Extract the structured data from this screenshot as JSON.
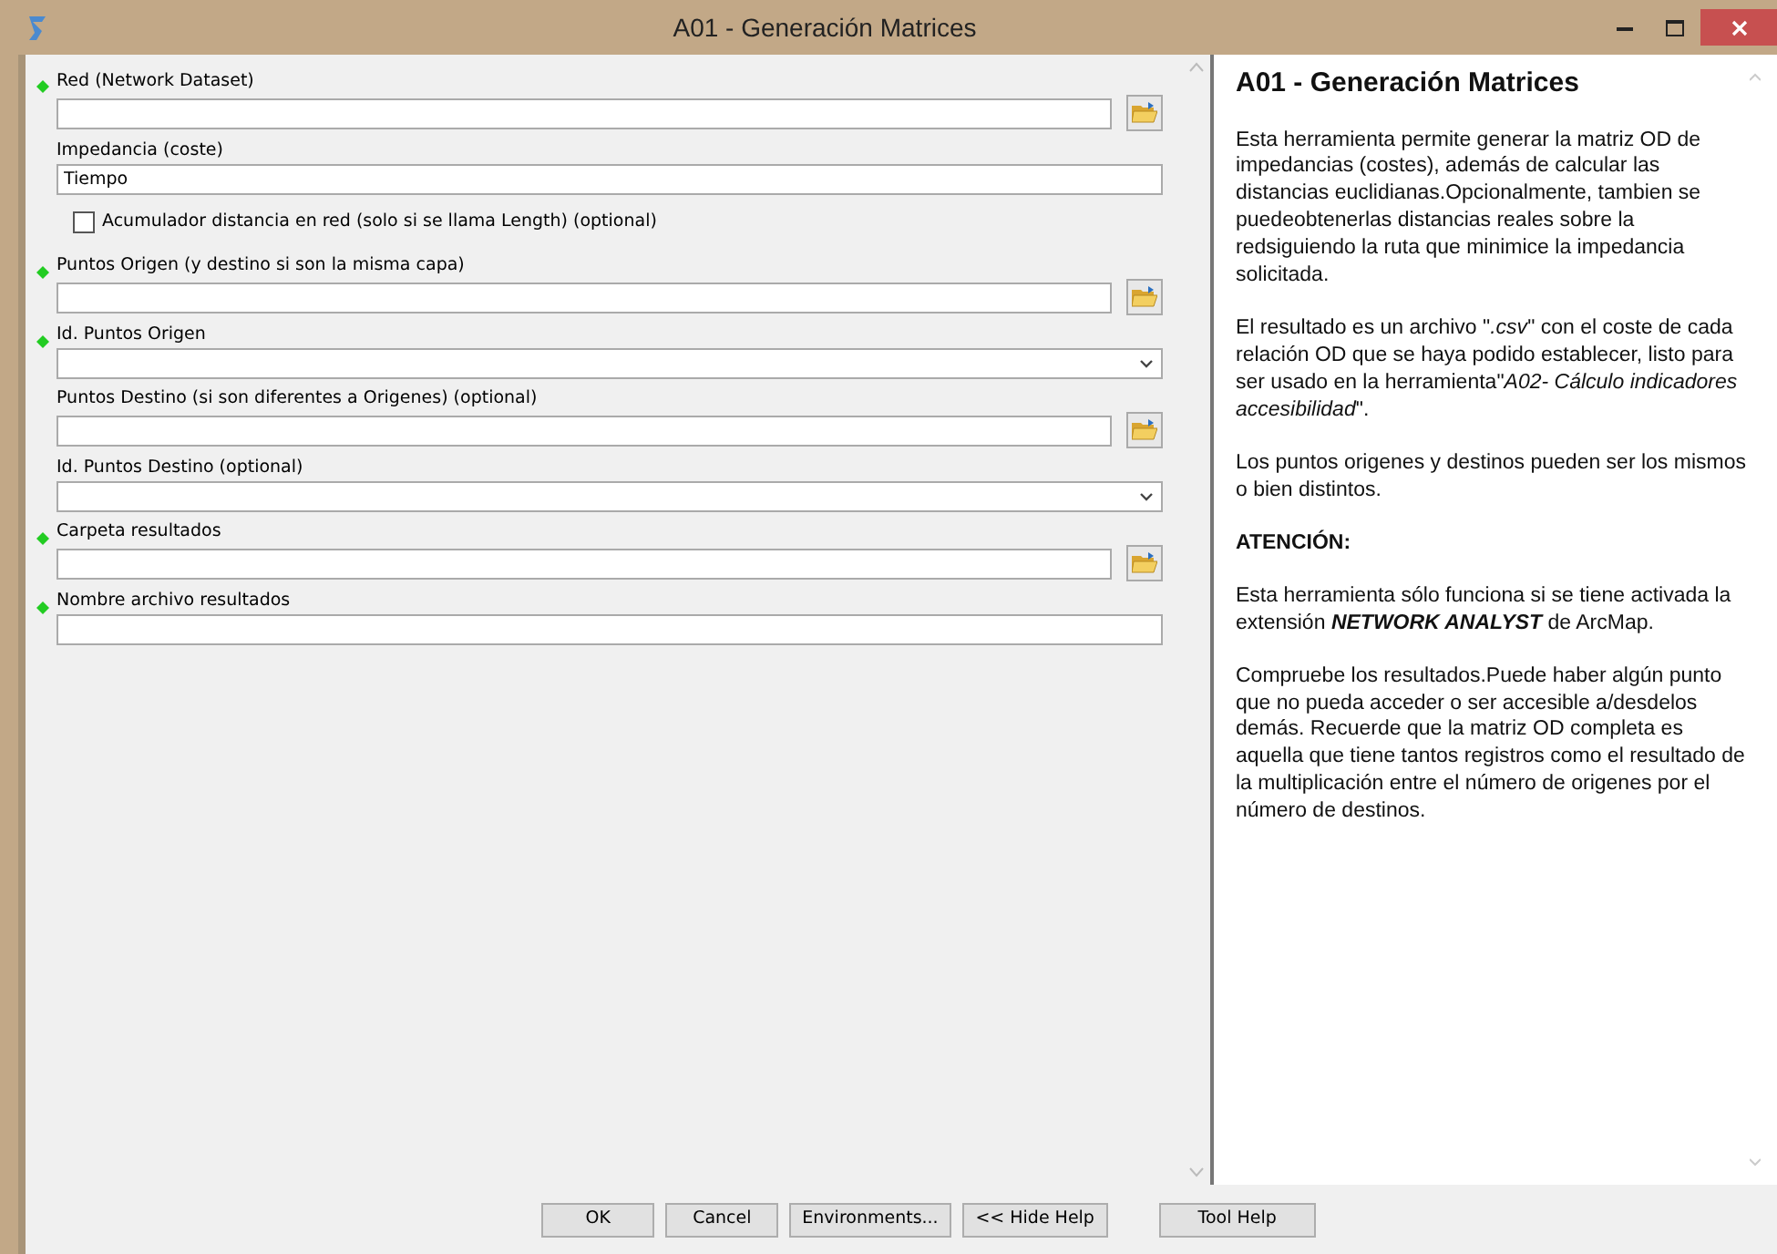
{
  "window": {
    "title": "A01 - Generación Matrices"
  },
  "parameters": [
    {
      "kind": "text",
      "label": "Red (Network Dataset)",
      "required": true,
      "browse": true
    },
    {
      "kind": "text",
      "label": "Impedancia (coste)",
      "required": false,
      "value": "Tiempo",
      "browse": false
    },
    {
      "kind": "checkbox",
      "label": "Acumulador distancia en red (solo si se llama Length) (optional)",
      "checked": false
    },
    {
      "kind": "text",
      "label": "Puntos Origen (y destino si son la misma capa)",
      "required": true,
      "browse": true
    },
    {
      "kind": "dropdown",
      "label": "Id. Puntos Origen",
      "required": true
    },
    {
      "kind": "text",
      "label": "Puntos Destino (si son diferentes a Origenes) (optional)",
      "required": false,
      "browse": true
    },
    {
      "kind": "dropdown",
      "label": "Id. Puntos Destino (optional)",
      "required": false
    },
    {
      "kind": "text",
      "label": "Carpeta resultados",
      "required": true,
      "browse": true
    },
    {
      "kind": "text",
      "label": "Nombre archivo resultados",
      "required": true,
      "browse": false
    }
  ],
  "help": {
    "title": "A01 - Generación Matrices",
    "paragraphs": [
      {
        "kind": "text",
        "text": "Esta herramienta permite generar la matriz OD de impedancias (costes), además de calcular las distancias euclidianas.Opcionalmente, tambien se puedeobtenerlas distancias reales sobre la redsiguiendo la ruta que minimice la impedancia solicitada."
      },
      {
        "kind": "text",
        "text": "El resultado es un archivo \"*.csv*\" con el coste de cada relación OD que se haya podido establecer, listo para ser usado en la herramienta\"*A02- Cálculo indicadores accesibilidad*\"."
      },
      {
        "kind": "text",
        "text": "Los puntos origenes y destinos pueden ser los mismos o bien distintos."
      },
      {
        "kind": "heading",
        "text": "ATENCIÓN:"
      },
      {
        "kind": "text",
        "text": "Esta herramienta sólo funciona si se tiene activada la extensión **NETWORK ANALYST** de ArcMap."
      },
      {
        "kind": "text",
        "text": "Compruebe los resultados.Puede haber algún punto que no pueda acceder o ser accesible a/desdelos demás. Recuerde que la matriz OD completa es aquella que tiene tantos registros como el resultado de la multiplicación entre el número de origenes por el número de destinos."
      }
    ]
  },
  "buttons": [
    "OK",
    "Cancel",
    "Environments...",
    "<< Hide Help",
    "Tool Help"
  ]
}
